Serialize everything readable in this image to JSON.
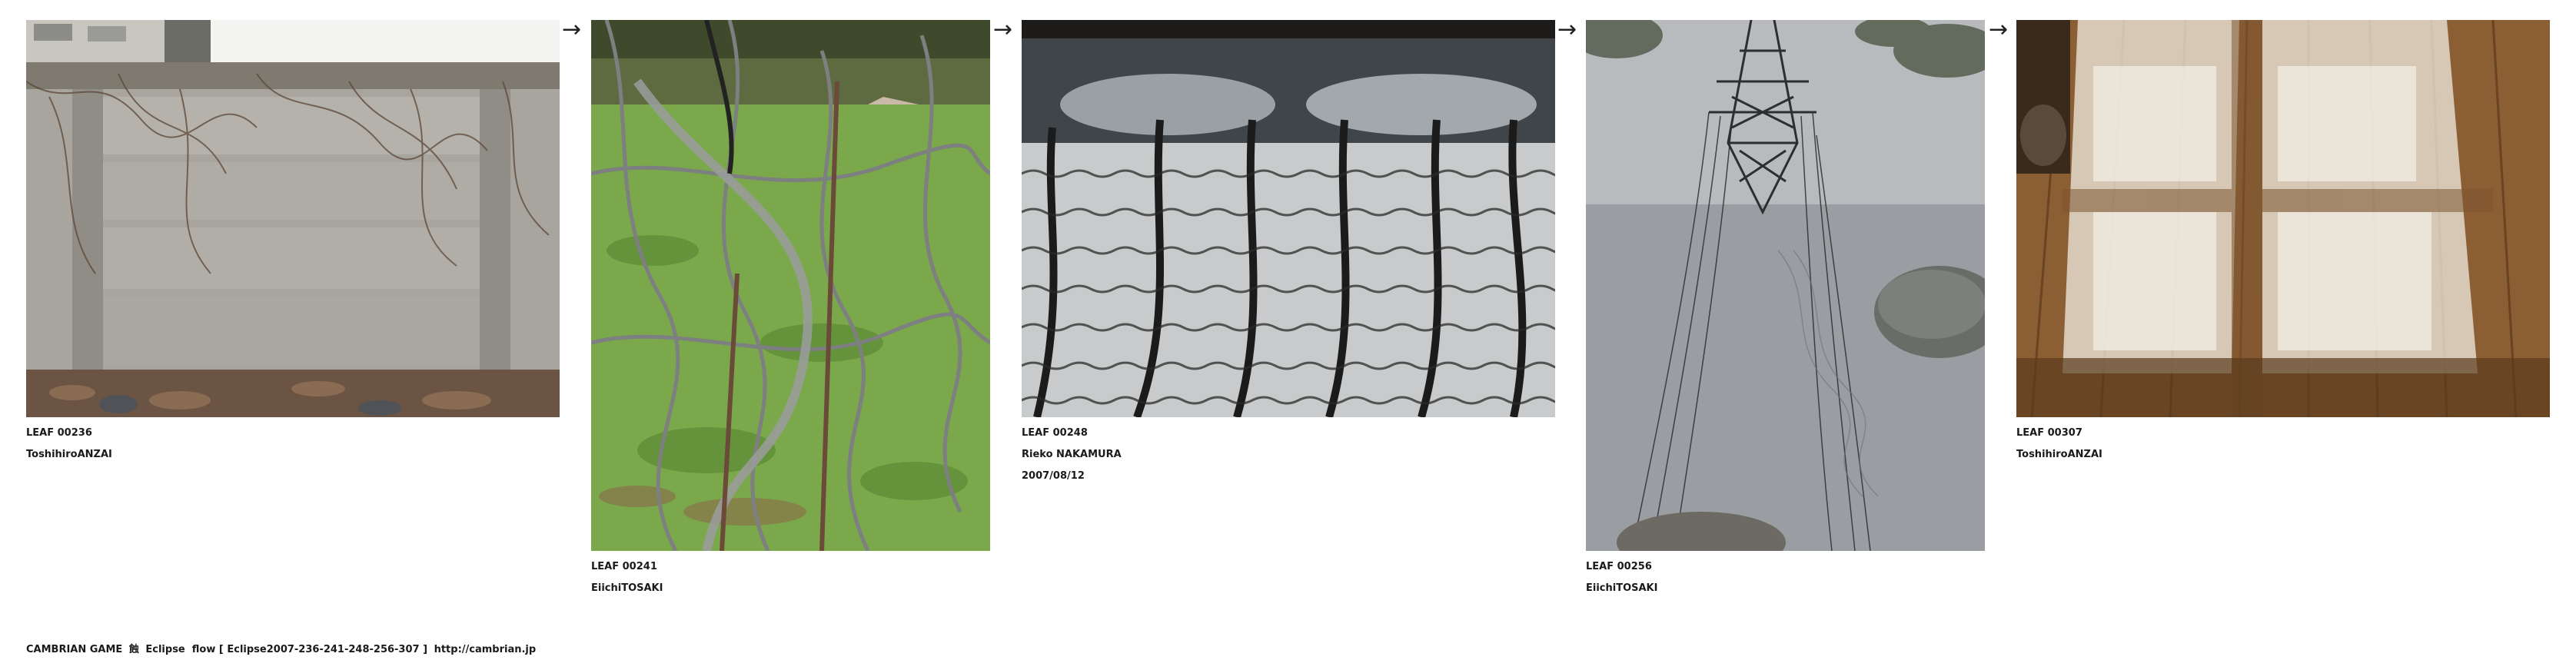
{
  "leaves": [
    {
      "code": "LEAF 00236",
      "author": "ToshihiroANZAI",
      "date": "",
      "icon": "concrete-wall-with-vines-photo"
    },
    {
      "code": "LEAF 00241",
      "author": "EiichiTOSAKI",
      "date": "",
      "icon": "wire-fence-on-grass-photo"
    },
    {
      "code": "LEAF 00248",
      "author": "Rieko NAKAMURA",
      "date": "2007/08/12",
      "icon": "water-ripple-reflection-photo"
    },
    {
      "code": "LEAF 00256",
      "author": "EiichiTOSAKI",
      "date": "",
      "icon": "power-pylon-reflection-photo"
    },
    {
      "code": "LEAF 00307",
      "author": "ToshihiroANZAI",
      "date": "",
      "icon": "wooden-floor-light-photo"
    }
  ],
  "arrow_glyph": "→",
  "footer": {
    "game": "CAMBRIAN GAME",
    "eclipse_mark": "蝕",
    "flow_text": "Eclipse  flow [ Eclipse2007-236-241-248-256-307 ]",
    "url": "http://cambrian.jp"
  }
}
